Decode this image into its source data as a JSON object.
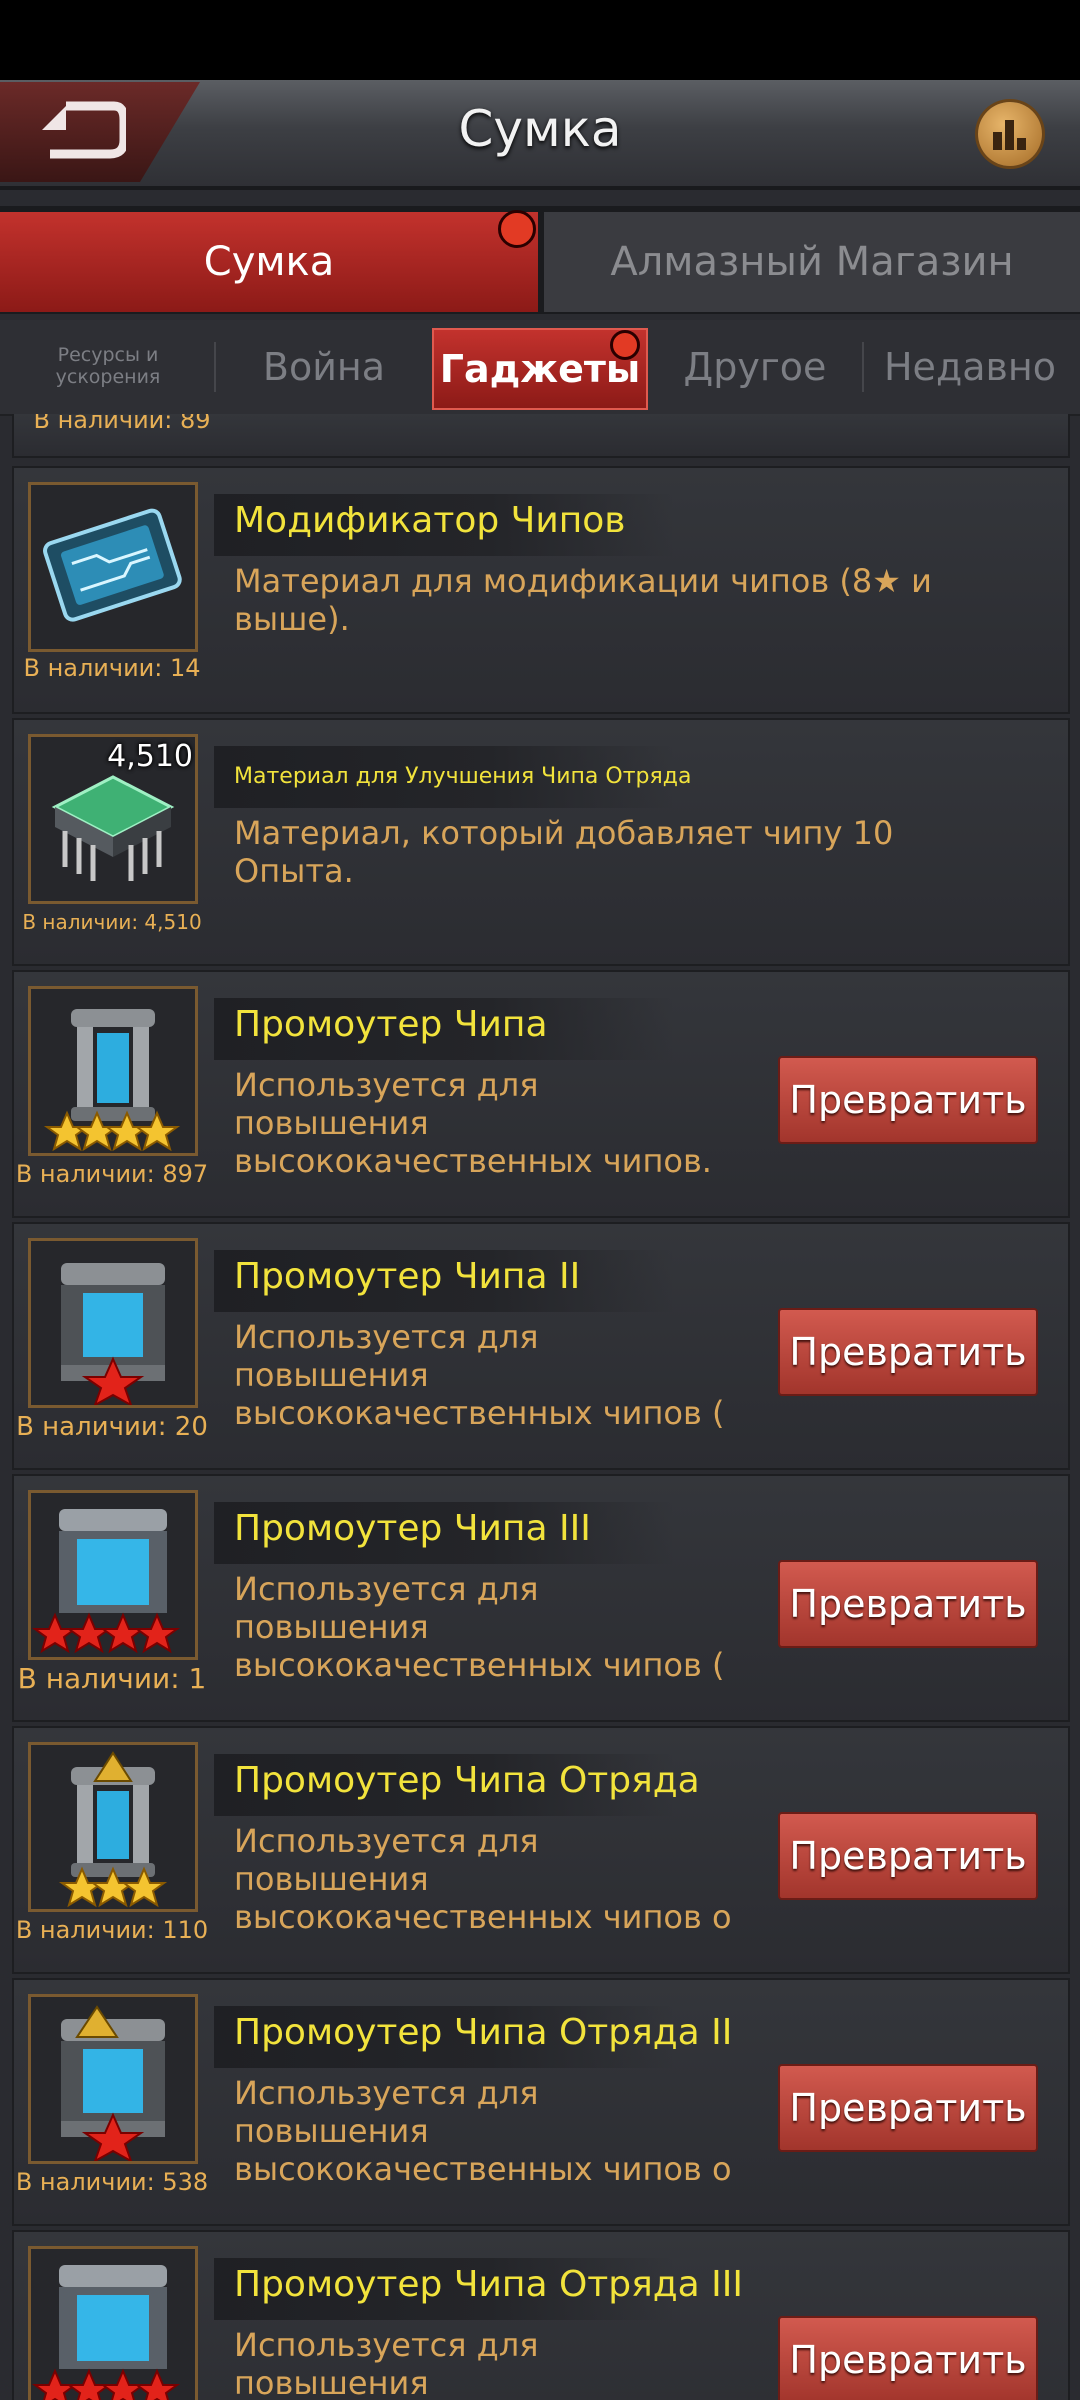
{
  "header": {
    "title": "Сумка"
  },
  "tabs": {
    "bag": "Сумка",
    "shop": "Алмазный Магазин"
  },
  "subtabs": {
    "resources": "Ресурсы и ускорения",
    "war": "Война",
    "gadgets": "Гаджеты",
    "other": "Другое",
    "recent": "Недавно"
  },
  "partial_item": {
    "available": "В наличии: 89"
  },
  "items": [
    {
      "name": "Модификатор Чипов",
      "desc1": "Материал для модификации чипов (8★ и",
      "desc2": "выше).",
      "desc3": "",
      "available": "В наличии: 14",
      "badge": ""
    },
    {
      "name": "Материал для Улучшения Чипа Отряда",
      "desc1": "Материал, который добавляет чипу 10",
      "desc2": "Опыта.",
      "desc3": "",
      "available": "В наличии: 4,510",
      "badge": "4,510"
    },
    {
      "name": "Промоутер Чипа",
      "desc1": "Используется для",
      "desc2": "повышения",
      "desc3": "высококачественных чипов.",
      "available": "В наличии: 897",
      "button": "Превратить"
    },
    {
      "name": "Промоутер Чипа II",
      "desc1": "Используется для",
      "desc2": "повышения",
      "desc3": "высококачественных чипов (",
      "available": "В наличии: 20",
      "button": "Превратить"
    },
    {
      "name": "Промоутер Чипа III",
      "desc1": "Используется для",
      "desc2": "повышения",
      "desc3": "высококачественных чипов (",
      "available": "В наличии: 1",
      "button": "Превратить"
    },
    {
      "name": "Промоутер Чипа Отряда",
      "desc1": "Используется для",
      "desc2": "повышения",
      "desc3": "высококачественных чипов о",
      "available": "В наличии: 110",
      "button": "Превратить"
    },
    {
      "name": "Промоутер Чипа Отряда II",
      "desc1": "Используется для",
      "desc2": "повышения",
      "desc3": "высококачественных чипов о",
      "available": "В наличии: 538",
      "button": "Превратить"
    },
    {
      "name": "Промоутер Чипа Отряда III",
      "desc1": "Используется для",
      "desc2": "повышения",
      "desc3": "",
      "available": "",
      "button": "Превратить"
    }
  ],
  "colors": {
    "accent_red": "#c3322d",
    "name_yellow": "#f2e33c",
    "desc_orange": "#d8a55a"
  }
}
